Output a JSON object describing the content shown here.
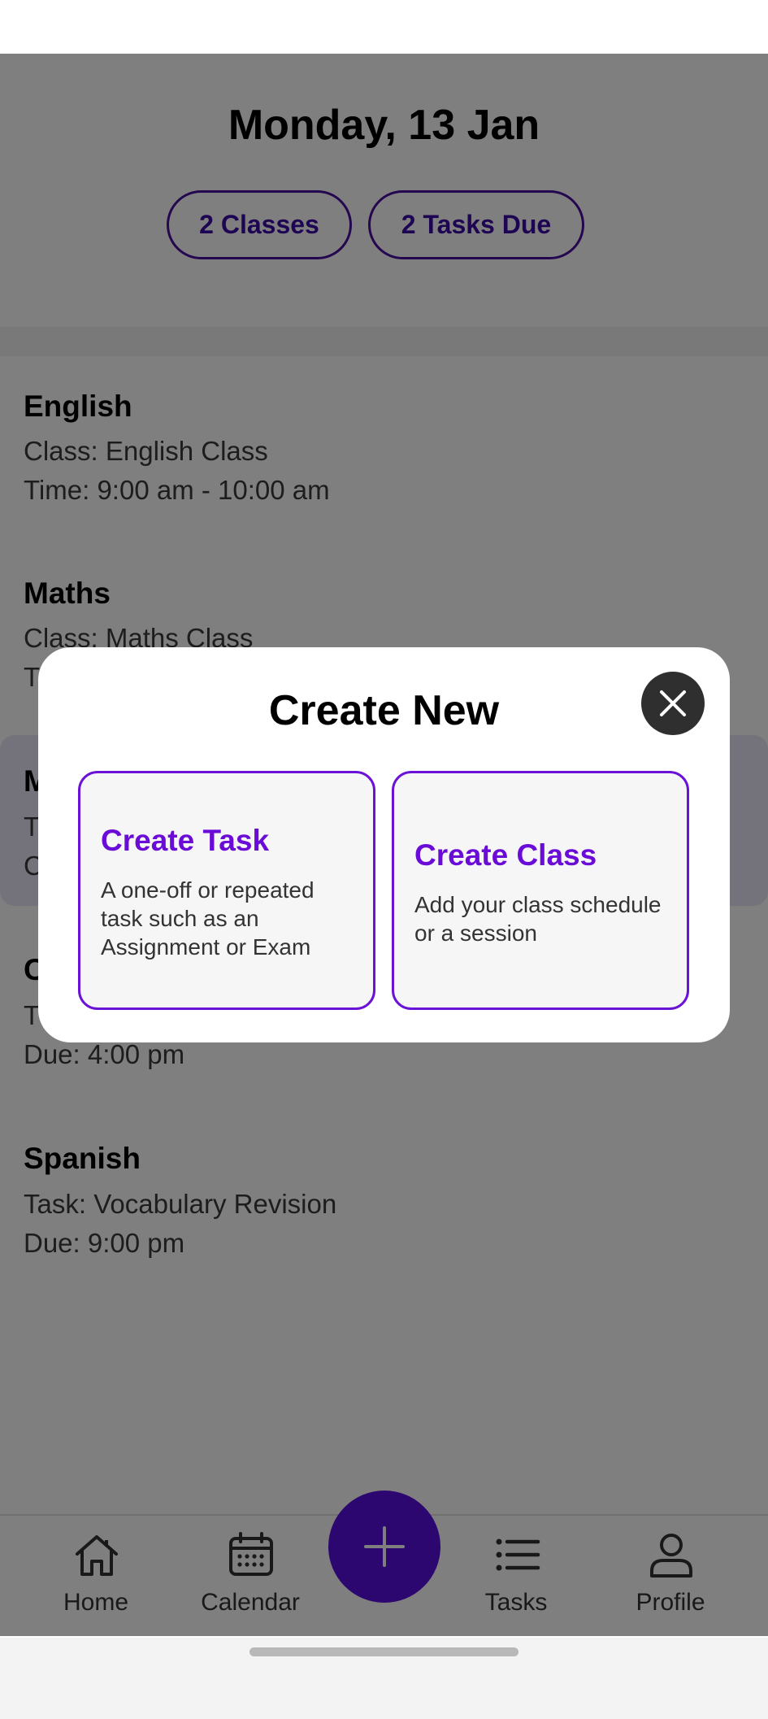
{
  "header": {
    "date": "Monday, 13 Jan",
    "summary_pills": [
      "2 Classes",
      "2 Tasks Due"
    ]
  },
  "cards": [
    {
      "subject": "English",
      "line1": "Class: English Class",
      "line2": "Time: 9:00 am - 10:00 am"
    },
    {
      "subject": "Maths",
      "line1": "Class: Maths Class",
      "line2": "T"
    },
    {
      "subject": "M",
      "line1": "T",
      "line2": "C"
    },
    {
      "subject": "C",
      "line1": "T",
      "line2": "Due: 4:00 pm"
    },
    {
      "subject": "Spanish",
      "line1": "Task: Vocabulary Revision",
      "line2": "Due: 9:00 pm"
    }
  ],
  "modal": {
    "title": "Create New",
    "close_icon": "close-icon",
    "options": [
      {
        "title": "Create Task",
        "description": "A one-off or repeated task such as an Assignment or Exam"
      },
      {
        "title": "Create Class",
        "description": "Add your class schedule or a session"
      }
    ]
  },
  "bottom_nav": {
    "items": [
      {
        "label": "Home",
        "icon": "home-icon"
      },
      {
        "label": "Calendar",
        "icon": "calendar-icon"
      },
      {
        "label": "Tasks",
        "icon": "list-icon"
      },
      {
        "label": "Profile",
        "icon": "person-icon"
      }
    ],
    "fab_icon": "plus-icon"
  },
  "colors": {
    "accent": "#5a0fe0",
    "accent_text": "#6a0bd8",
    "pill_border": "#4a0fa0",
    "highlight_card": "#e8e6f8",
    "scrim": "rgba(0,0,0,0.5)"
  }
}
